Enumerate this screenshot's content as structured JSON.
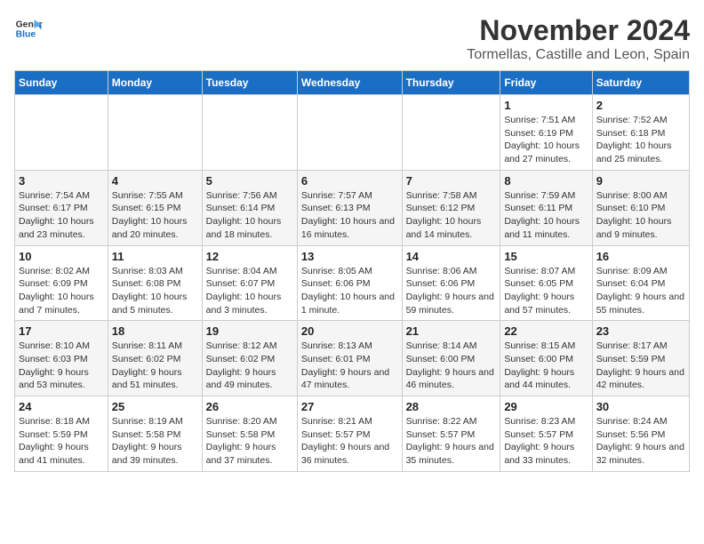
{
  "logo": {
    "line1": "General",
    "line2": "Blue"
  },
  "header": {
    "month": "November 2024",
    "location": "Tormellas, Castille and Leon, Spain"
  },
  "weekdays": [
    "Sunday",
    "Monday",
    "Tuesday",
    "Wednesday",
    "Thursday",
    "Friday",
    "Saturday"
  ],
  "weeks": [
    [
      {
        "day": "",
        "info": ""
      },
      {
        "day": "",
        "info": ""
      },
      {
        "day": "",
        "info": ""
      },
      {
        "day": "",
        "info": ""
      },
      {
        "day": "",
        "info": ""
      },
      {
        "day": "1",
        "info": "Sunrise: 7:51 AM\nSunset: 6:19 PM\nDaylight: 10 hours and 27 minutes."
      },
      {
        "day": "2",
        "info": "Sunrise: 7:52 AM\nSunset: 6:18 PM\nDaylight: 10 hours and 25 minutes."
      }
    ],
    [
      {
        "day": "3",
        "info": "Sunrise: 7:54 AM\nSunset: 6:17 PM\nDaylight: 10 hours and 23 minutes."
      },
      {
        "day": "4",
        "info": "Sunrise: 7:55 AM\nSunset: 6:15 PM\nDaylight: 10 hours and 20 minutes."
      },
      {
        "day": "5",
        "info": "Sunrise: 7:56 AM\nSunset: 6:14 PM\nDaylight: 10 hours and 18 minutes."
      },
      {
        "day": "6",
        "info": "Sunrise: 7:57 AM\nSunset: 6:13 PM\nDaylight: 10 hours and 16 minutes."
      },
      {
        "day": "7",
        "info": "Sunrise: 7:58 AM\nSunset: 6:12 PM\nDaylight: 10 hours and 14 minutes."
      },
      {
        "day": "8",
        "info": "Sunrise: 7:59 AM\nSunset: 6:11 PM\nDaylight: 10 hours and 11 minutes."
      },
      {
        "day": "9",
        "info": "Sunrise: 8:00 AM\nSunset: 6:10 PM\nDaylight: 10 hours and 9 minutes."
      }
    ],
    [
      {
        "day": "10",
        "info": "Sunrise: 8:02 AM\nSunset: 6:09 PM\nDaylight: 10 hours and 7 minutes."
      },
      {
        "day": "11",
        "info": "Sunrise: 8:03 AM\nSunset: 6:08 PM\nDaylight: 10 hours and 5 minutes."
      },
      {
        "day": "12",
        "info": "Sunrise: 8:04 AM\nSunset: 6:07 PM\nDaylight: 10 hours and 3 minutes."
      },
      {
        "day": "13",
        "info": "Sunrise: 8:05 AM\nSunset: 6:06 PM\nDaylight: 10 hours and 1 minute."
      },
      {
        "day": "14",
        "info": "Sunrise: 8:06 AM\nSunset: 6:06 PM\nDaylight: 9 hours and 59 minutes."
      },
      {
        "day": "15",
        "info": "Sunrise: 8:07 AM\nSunset: 6:05 PM\nDaylight: 9 hours and 57 minutes."
      },
      {
        "day": "16",
        "info": "Sunrise: 8:09 AM\nSunset: 6:04 PM\nDaylight: 9 hours and 55 minutes."
      }
    ],
    [
      {
        "day": "17",
        "info": "Sunrise: 8:10 AM\nSunset: 6:03 PM\nDaylight: 9 hours and 53 minutes."
      },
      {
        "day": "18",
        "info": "Sunrise: 8:11 AM\nSunset: 6:02 PM\nDaylight: 9 hours and 51 minutes."
      },
      {
        "day": "19",
        "info": "Sunrise: 8:12 AM\nSunset: 6:02 PM\nDaylight: 9 hours and 49 minutes."
      },
      {
        "day": "20",
        "info": "Sunrise: 8:13 AM\nSunset: 6:01 PM\nDaylight: 9 hours and 47 minutes."
      },
      {
        "day": "21",
        "info": "Sunrise: 8:14 AM\nSunset: 6:00 PM\nDaylight: 9 hours and 46 minutes."
      },
      {
        "day": "22",
        "info": "Sunrise: 8:15 AM\nSunset: 6:00 PM\nDaylight: 9 hours and 44 minutes."
      },
      {
        "day": "23",
        "info": "Sunrise: 8:17 AM\nSunset: 5:59 PM\nDaylight: 9 hours and 42 minutes."
      }
    ],
    [
      {
        "day": "24",
        "info": "Sunrise: 8:18 AM\nSunset: 5:59 PM\nDaylight: 9 hours and 41 minutes."
      },
      {
        "day": "25",
        "info": "Sunrise: 8:19 AM\nSunset: 5:58 PM\nDaylight: 9 hours and 39 minutes."
      },
      {
        "day": "26",
        "info": "Sunrise: 8:20 AM\nSunset: 5:58 PM\nDaylight: 9 hours and 37 minutes."
      },
      {
        "day": "27",
        "info": "Sunrise: 8:21 AM\nSunset: 5:57 PM\nDaylight: 9 hours and 36 minutes."
      },
      {
        "day": "28",
        "info": "Sunrise: 8:22 AM\nSunset: 5:57 PM\nDaylight: 9 hours and 35 minutes."
      },
      {
        "day": "29",
        "info": "Sunrise: 8:23 AM\nSunset: 5:57 PM\nDaylight: 9 hours and 33 minutes."
      },
      {
        "day": "30",
        "info": "Sunrise: 8:24 AM\nSunset: 5:56 PM\nDaylight: 9 hours and 32 minutes."
      }
    ]
  ]
}
